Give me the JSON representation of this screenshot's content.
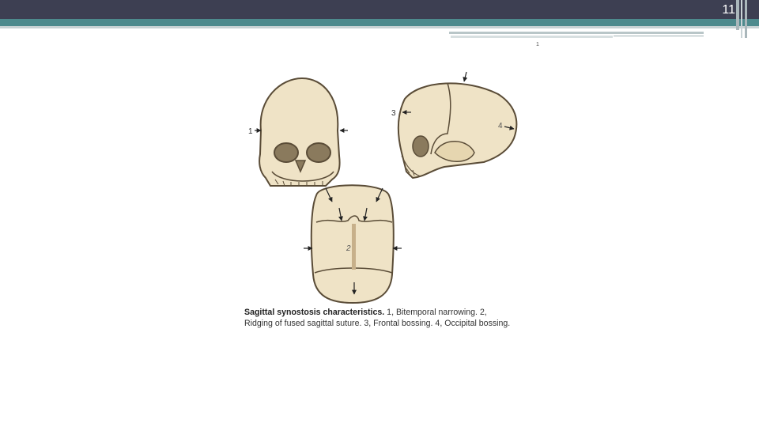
{
  "slide": {
    "number": "11",
    "footnote_mark": "1"
  },
  "figure": {
    "labels": {
      "bitemporal": "1",
      "sagittal_suture": "2",
      "frontal_bossing": "3",
      "occipital_bossing": "4"
    }
  },
  "caption": {
    "title": "Sagittal synostosis characteristics.",
    "body": " 1, Bitemporal narrowing. 2, Ridging of fused sagittal suture. 3, Frontal bossing. 4, Occipital bossing."
  },
  "colors": {
    "topbar": "#3d3f52",
    "teal_band": "#4d8a8d",
    "bone": "#efe3c6",
    "bone_outline": "#5a4c37"
  }
}
